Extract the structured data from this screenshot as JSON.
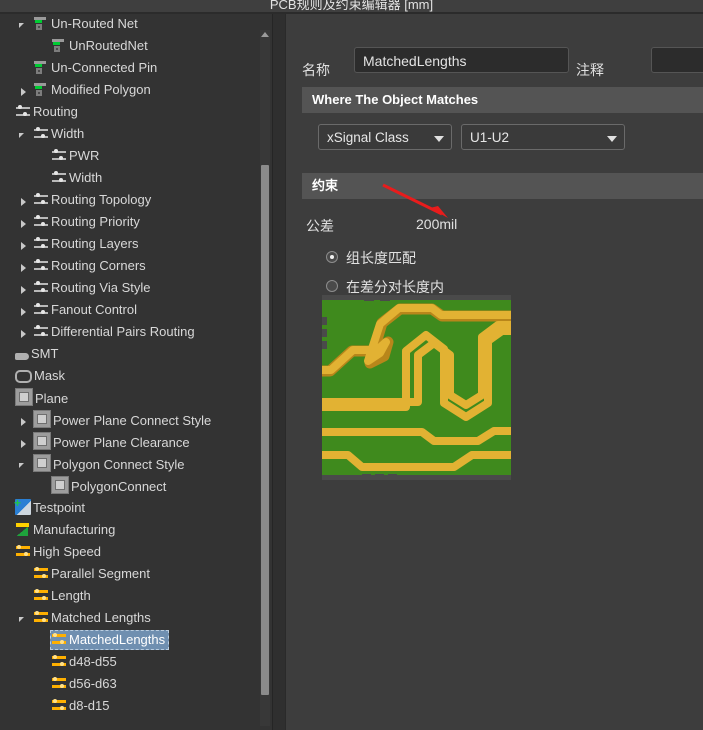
{
  "window": {
    "title": "PCB规则及约束编辑器 [mm]"
  },
  "tree": {
    "scrollbar": {
      "up_icon": "scroll-up-arrow"
    },
    "items": [
      {
        "label": "Un-Routed Net",
        "indent": 1,
        "icon": "net",
        "toggle": "expanded"
      },
      {
        "label": "UnRoutedNet",
        "indent": 2,
        "icon": "net",
        "toggle": "none"
      },
      {
        "label": "Un-Connected Pin",
        "indent": 1,
        "icon": "net",
        "toggle": "none"
      },
      {
        "label": "Modified Polygon",
        "indent": 1,
        "icon": "net",
        "toggle": "collapsed"
      },
      {
        "label": "Routing",
        "indent": 0,
        "icon": "routing",
        "toggle": "none"
      },
      {
        "label": "Width",
        "indent": 1,
        "icon": "routing",
        "toggle": "expanded"
      },
      {
        "label": "PWR",
        "indent": 2,
        "icon": "routing",
        "toggle": "none"
      },
      {
        "label": "Width",
        "indent": 2,
        "icon": "routing",
        "toggle": "none"
      },
      {
        "label": "Routing Topology",
        "indent": 1,
        "icon": "routing",
        "toggle": "collapsed"
      },
      {
        "label": "Routing Priority",
        "indent": 1,
        "icon": "routing",
        "toggle": "collapsed"
      },
      {
        "label": "Routing Layers",
        "indent": 1,
        "icon": "routing",
        "toggle": "collapsed"
      },
      {
        "label": "Routing Corners",
        "indent": 1,
        "icon": "routing",
        "toggle": "collapsed"
      },
      {
        "label": "Routing Via Style",
        "indent": 1,
        "icon": "routing",
        "toggle": "collapsed"
      },
      {
        "label": "Fanout Control",
        "indent": 1,
        "icon": "routing",
        "toggle": "collapsed"
      },
      {
        "label": "Differential Pairs Routing",
        "indent": 1,
        "icon": "routing",
        "toggle": "collapsed"
      },
      {
        "label": "SMT",
        "indent": 0,
        "icon": "smt",
        "toggle": "none"
      },
      {
        "label": "Mask",
        "indent": 0,
        "icon": "mask",
        "toggle": "none"
      },
      {
        "label": "Plane",
        "indent": 0,
        "icon": "plane",
        "toggle": "none"
      },
      {
        "label": "Power Plane Connect Style",
        "indent": 1,
        "icon": "plane",
        "toggle": "collapsed"
      },
      {
        "label": "Power Plane Clearance",
        "indent": 1,
        "icon": "plane",
        "toggle": "collapsed"
      },
      {
        "label": "Polygon Connect Style",
        "indent": 1,
        "icon": "plane",
        "toggle": "expanded"
      },
      {
        "label": "PolygonConnect",
        "indent": 2,
        "icon": "plane",
        "toggle": "none"
      },
      {
        "label": "Testpoint",
        "indent": 0,
        "icon": "testpoint",
        "toggle": "none"
      },
      {
        "label": "Manufacturing",
        "indent": 0,
        "icon": "manu",
        "toggle": "none"
      },
      {
        "label": "High Speed",
        "indent": 0,
        "icon": "hs",
        "toggle": "none"
      },
      {
        "label": "Parallel Segment",
        "indent": 1,
        "icon": "hs",
        "toggle": "none"
      },
      {
        "label": "Length",
        "indent": 1,
        "icon": "hs",
        "toggle": "none"
      },
      {
        "label": "Matched Lengths",
        "indent": 1,
        "icon": "hs",
        "toggle": "expanded"
      },
      {
        "label": "MatchedLengths",
        "indent": 2,
        "icon": "hs",
        "toggle": "none",
        "selected": true
      },
      {
        "label": "d48-d55",
        "indent": 2,
        "icon": "hs",
        "toggle": "none"
      },
      {
        "label": "d56-d63",
        "indent": 2,
        "icon": "hs",
        "toggle": "none"
      },
      {
        "label": "d8-d15",
        "indent": 2,
        "icon": "hs",
        "toggle": "none"
      }
    ]
  },
  "form": {
    "name_label": "名称",
    "name_value": "MatchedLengths",
    "comment_label": "注释",
    "comment_value": "",
    "where_section": "Where The Object Matches",
    "scope_select": "xSignal Class",
    "scope_value": "U1-U2",
    "constraint_section": "约束",
    "tolerance_label": "公差",
    "tolerance_value": "200mil",
    "radios": [
      {
        "label": "组长度匹配",
        "selected": true
      },
      {
        "label": "在差分对长度内",
        "selected": false
      }
    ]
  },
  "annotation": {
    "name": "red-arrow-pointer",
    "color": "#e81c1c",
    "points_at": "200mil"
  },
  "preview": {
    "name": "pcb-matched-length-preview",
    "board_color": "#3f8a1d",
    "trace_color": "#e2b233",
    "trace_shadow": "#b8861a"
  }
}
